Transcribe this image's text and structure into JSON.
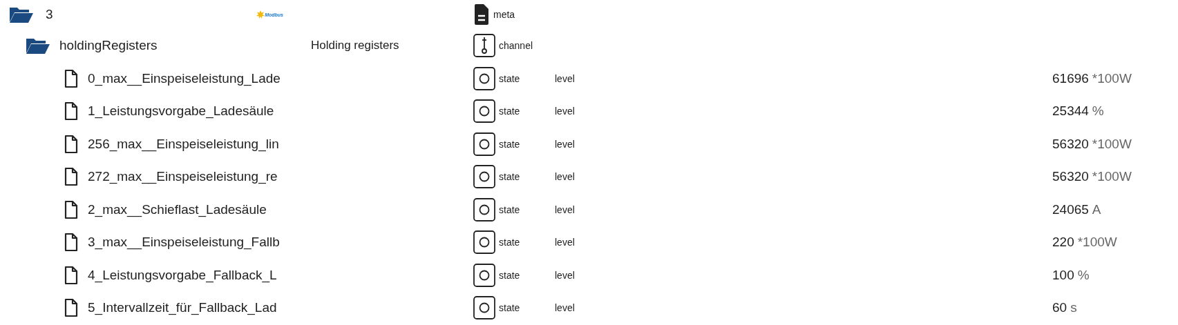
{
  "tree": [
    {
      "kind": "folder",
      "name": "3",
      "expanded": true,
      "logo_text": "Modbus",
      "type": {
        "kind": "meta",
        "label": "meta"
      },
      "children": [
        {
          "kind": "folder",
          "name": "holdingRegisters",
          "expanded": true,
          "description": "Holding registers",
          "type": {
            "kind": "channel",
            "label": "channel"
          },
          "children": [
            {
              "kind": "file",
              "name": "0_max__Einspeiseleistung_Lade",
              "type": {
                "kind": "state",
                "label": "state"
              },
              "role": "level",
              "value": "61696",
              "unit": "*100W"
            },
            {
              "kind": "file",
              "name": "1_Leistungsvorgabe_Ladesäule",
              "type": {
                "kind": "state",
                "label": "state"
              },
              "role": "level",
              "value": "25344",
              "unit": "%"
            },
            {
              "kind": "file",
              "name": "256_max__Einspeiseleistung_lin",
              "type": {
                "kind": "state",
                "label": "state"
              },
              "role": "level",
              "value": "56320",
              "unit": "*100W"
            },
            {
              "kind": "file",
              "name": "272_max__Einspeiseleistung_re",
              "type": {
                "kind": "state",
                "label": "state"
              },
              "role": "level",
              "value": "56320",
              "unit": "*100W"
            },
            {
              "kind": "file",
              "name": "2_max__Schieflast_Ladesäule",
              "type": {
                "kind": "state",
                "label": "state"
              },
              "role": "level",
              "value": "24065",
              "unit": "A"
            },
            {
              "kind": "file",
              "name": "3_max__Einspeiseleistung_Fallb",
              "type": {
                "kind": "state",
                "label": "state"
              },
              "role": "level",
              "value": "220",
              "unit": "*100W"
            },
            {
              "kind": "file",
              "name": "4_Leistungsvorgabe_Fallback_L",
              "type": {
                "kind": "state",
                "label": "state"
              },
              "role": "level",
              "value": "100",
              "unit": "%"
            },
            {
              "kind": "file",
              "name": "5_Intervallzeit_für_Fallback_Lad",
              "type": {
                "kind": "state",
                "label": "state"
              },
              "role": "level",
              "value": "60",
              "unit": "s"
            }
          ]
        }
      ]
    }
  ]
}
